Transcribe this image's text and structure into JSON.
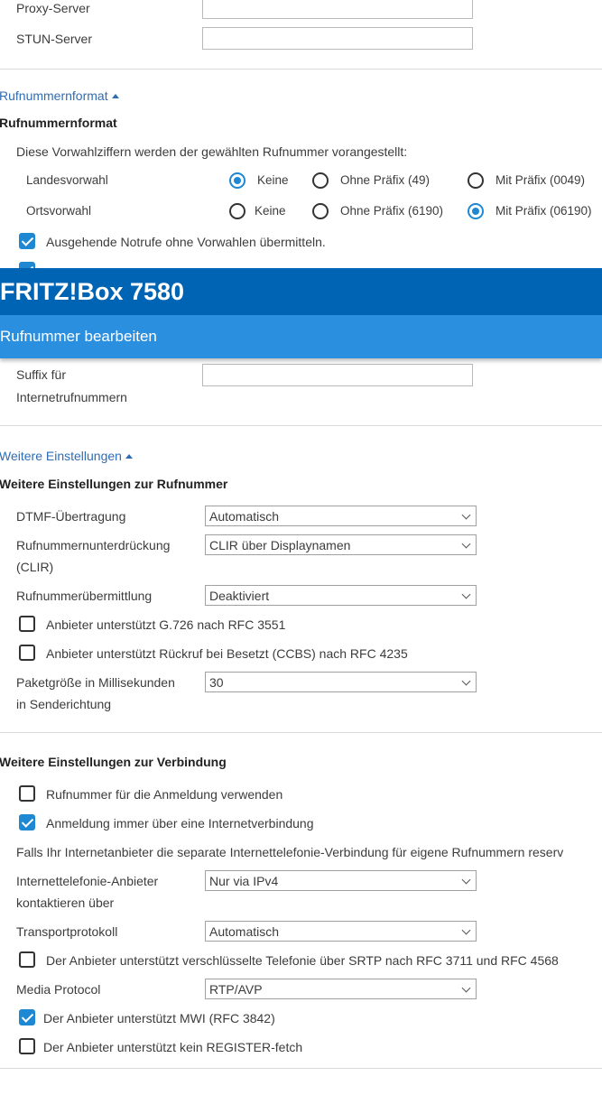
{
  "server": {
    "proxy_label": "Proxy-Server",
    "proxy_value": "",
    "stun_label": "STUN-Server",
    "stun_value": ""
  },
  "number_format": {
    "toggle_label": "Rufnummernformat",
    "heading": "Rufnummernformat",
    "intro": "Diese Vorwahlziffern werden der gewählten Rufnummer vorangestellt:",
    "country": {
      "label": "Landesvorwahl",
      "options": [
        "Keine",
        "Ohne Präfix (49)",
        "Mit Präfix (0049)"
      ],
      "selected": 0
    },
    "area": {
      "label": "Ortsvorwahl",
      "options": [
        "Keine",
        "Ohne Präfix (6190)",
        "Mit Präfix (06190)"
      ],
      "selected": 2
    },
    "emergency_label": "Ausgehende Notrufe ohne Vorwahlen übermitteln.",
    "emergency_checked": true,
    "hidden_partial_checked": true
  },
  "header": {
    "product": "FRITZ!Box 7580",
    "subtitle": "Rufnummer bearbeiten"
  },
  "suffix": {
    "label_line1": "Suffix für",
    "label_line2": "Internetrufnummern",
    "value": ""
  },
  "more_settings": {
    "toggle_label": "Weitere Einstellungen",
    "heading": "Weitere Einstellungen zur Rufnummer",
    "dtmf_label": "DTMF-Übertragung",
    "dtmf_value": "Automatisch",
    "clir_label_line1": "Rufnummernunterdrückung",
    "clir_label_line2": "(CLIR)",
    "clir_value": "CLIR über Displaynamen",
    "clip_label": "Rufnummerübermittlung",
    "clip_value": "Deaktiviert",
    "g726_label": "Anbieter unterstützt G.726 nach RFC 3551",
    "g726_checked": false,
    "ccbs_label": "Anbieter unterstützt Rückruf bei Besetzt (CCBS) nach RFC 4235",
    "ccbs_checked": false,
    "packet_label_line1": "Paketgröße in Millisekunden",
    "packet_label_line2": "in Senderichtung",
    "packet_value": "30"
  },
  "connection": {
    "heading": "Weitere Einstellungen zur Verbindung",
    "use_number_label": "Rufnummer für die Anmeldung verwenden",
    "use_number_checked": false,
    "always_internet_label": "Anmeldung immer über eine Internetverbindung",
    "always_internet_checked": true,
    "info_text": "Falls Ihr Internetanbieter die separate Internettelefonie-Verbindung für eigene Rufnummern reserv",
    "provider_label_line1": "Internettelefonie-Anbieter",
    "provider_label_line2": "kontaktieren über",
    "provider_value": "Nur via IPv4",
    "transport_label": "Transportprotokoll",
    "transport_value": "Automatisch",
    "srtp_label": "Der Anbieter unterstützt verschlüsselte Telefonie über SRTP nach RFC 3711 und RFC 4568",
    "srtp_checked": false,
    "media_label": "Media Protocol",
    "media_value": "RTP/AVP",
    "mwi_label": "Der Anbieter unterstützt MWI (RFC 3842)",
    "mwi_checked": true,
    "register_label": "Der Anbieter unterstützt kein REGISTER-fetch",
    "register_checked": false
  },
  "colors": {
    "header_dark": "#0064b4",
    "header_light": "#2b8fe0",
    "accent": "#1e88d2",
    "link": "#2e6db4"
  }
}
